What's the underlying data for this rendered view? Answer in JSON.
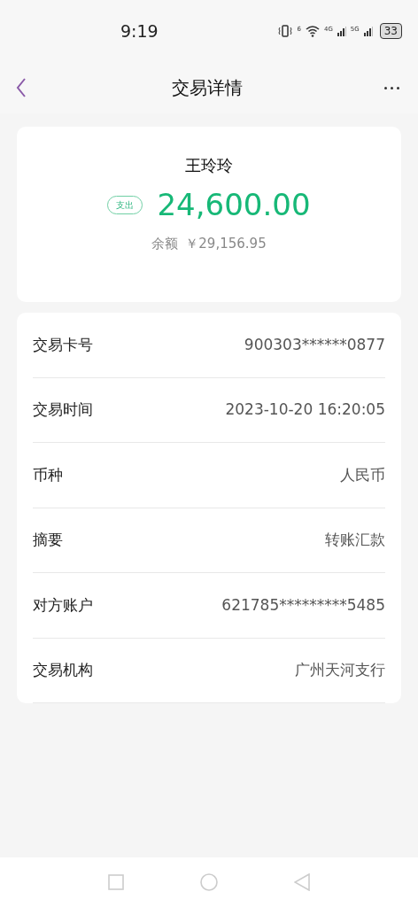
{
  "status_bar": {
    "time": "9:19",
    "wifi_label": "6",
    "sim_1": "4G",
    "sim_2": "5G",
    "battery": "33"
  },
  "header": {
    "title": "交易详情"
  },
  "summary": {
    "name": "王玲玲",
    "direction": "支出",
    "amount": "24,600.00",
    "balance_label": "余额",
    "balance": "￥29,156.95"
  },
  "details": [
    {
      "label": "交易卡号",
      "value": "900303******0877"
    },
    {
      "label": "交易时间",
      "value": "2023-10-20 16:20:05"
    },
    {
      "label": "币种",
      "value": "人民币"
    },
    {
      "label": "摘要",
      "value": "转账汇款"
    },
    {
      "label": "对方账户",
      "value": "621785*********5485"
    },
    {
      "label": "交易机构",
      "value": "广州天河支行"
    }
  ]
}
